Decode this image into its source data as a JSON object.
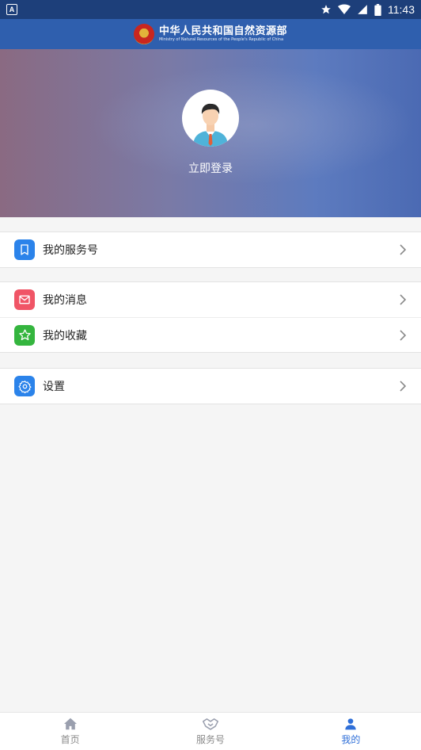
{
  "status_bar": {
    "time": "11:43",
    "app_icon_letter": "A",
    "icons": [
      "star-icon",
      "wifi-icon",
      "signal-icon",
      "battery-icon"
    ]
  },
  "header": {
    "title_cn": "中华人民共和国自然资源部",
    "title_en": "Ministry of Natural Resources of the People's Republic of China",
    "emblem_icon": "national-emblem-icon"
  },
  "profile": {
    "login_label": "立即登录",
    "avatar_icon": "default-user-avatar-icon"
  },
  "menu": {
    "group1": [
      {
        "label": "我的服务号",
        "icon": "bookmark-icon",
        "color": "#2b83ea"
      }
    ],
    "group2": [
      {
        "label": "我的消息",
        "icon": "mail-icon",
        "color": "#f05566"
      },
      {
        "label": "我的收藏",
        "icon": "star-icon",
        "color": "#34b53e"
      }
    ],
    "group3": [
      {
        "label": "设置",
        "icon": "gear-icon",
        "color": "#2b83ea"
      }
    ]
  },
  "tabbar": {
    "tabs": [
      {
        "label": "首页",
        "icon": "home-icon"
      },
      {
        "label": "服务号",
        "icon": "handshake-icon"
      },
      {
        "label": "我的",
        "icon": "user-icon"
      }
    ]
  },
  "colors": {
    "header_bg": "#2f5fae",
    "statusbar_bg": "#1d3f7a",
    "page_bg": "#f5f5f5",
    "tab_active": "#2f6fd8"
  }
}
